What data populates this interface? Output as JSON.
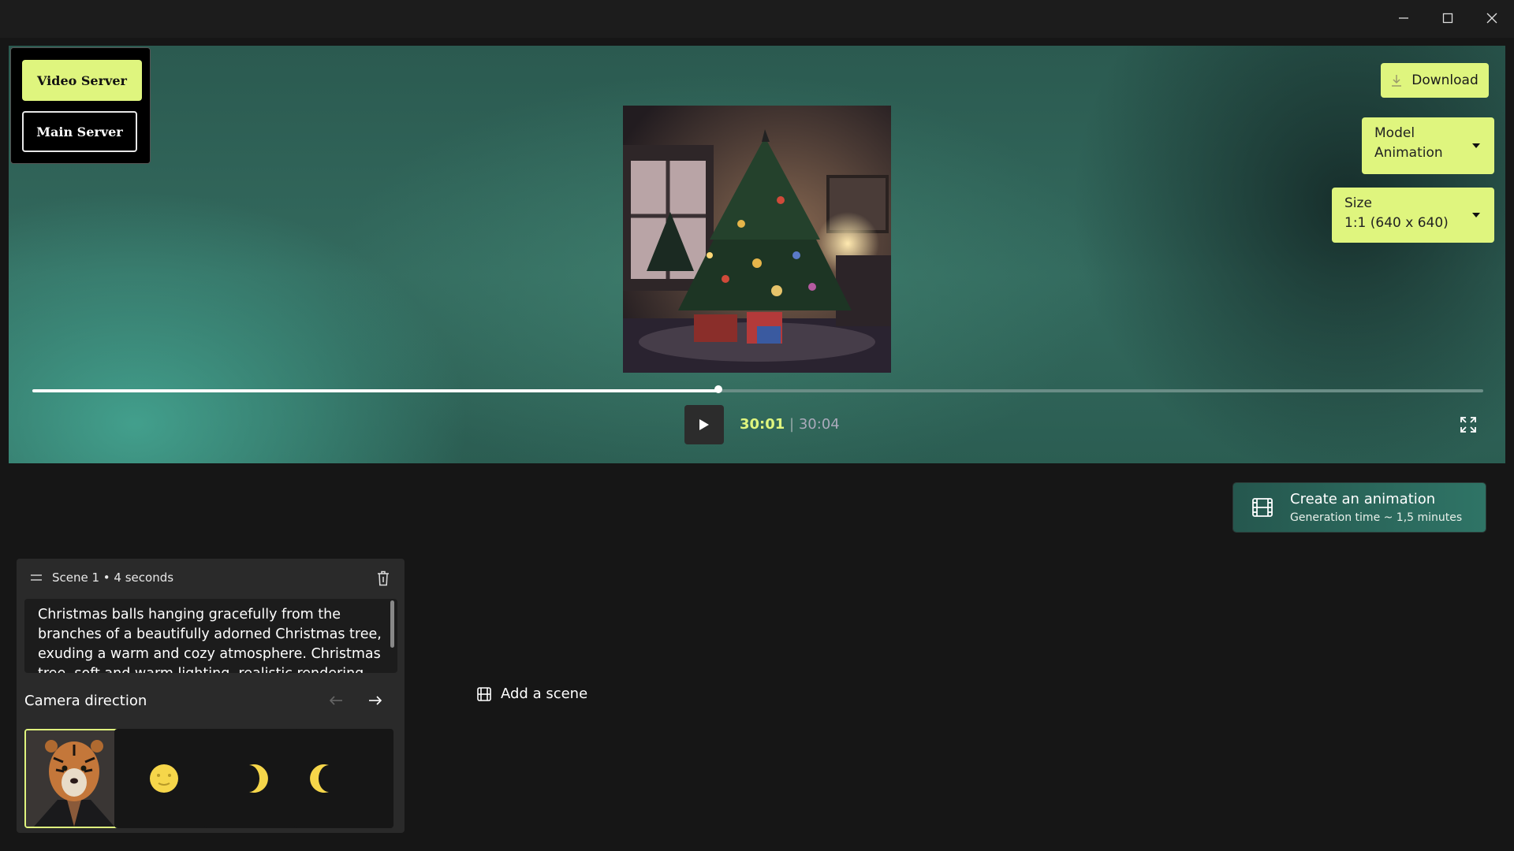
{
  "window": {
    "minimize_icon": "minimize-icon",
    "maximize_icon": "maximize-icon",
    "close_icon": "close-icon"
  },
  "servers": {
    "video_label": "Video Server",
    "main_label": "Main Server"
  },
  "toolbar": {
    "download_label": "Download"
  },
  "model_dropdown": {
    "line1": "Model",
    "line2": "Animation"
  },
  "size_dropdown": {
    "line1": "Size",
    "line2": "1:1 (640 x 640)"
  },
  "player": {
    "current_time": "30:01",
    "separator": "|",
    "total_time": "30:04",
    "progress": 0.473
  },
  "create": {
    "title": "Create an animation",
    "subtitle": "Generation time ~ 1,5 minutes"
  },
  "scene": {
    "title": "Scene 1 • 4 seconds",
    "prompt": "Christmas balls hanging gracefully from the branches of a beautifully adorned Christmas tree, exuding a warm and cozy atmosphere. Christmas tree, soft and warm lighting, realistic rendering",
    "camera_label": "Camera direction"
  },
  "add_scene_label": "Add a scene",
  "colors": {
    "accent": "#dff57e",
    "teal": "#2f7466"
  }
}
